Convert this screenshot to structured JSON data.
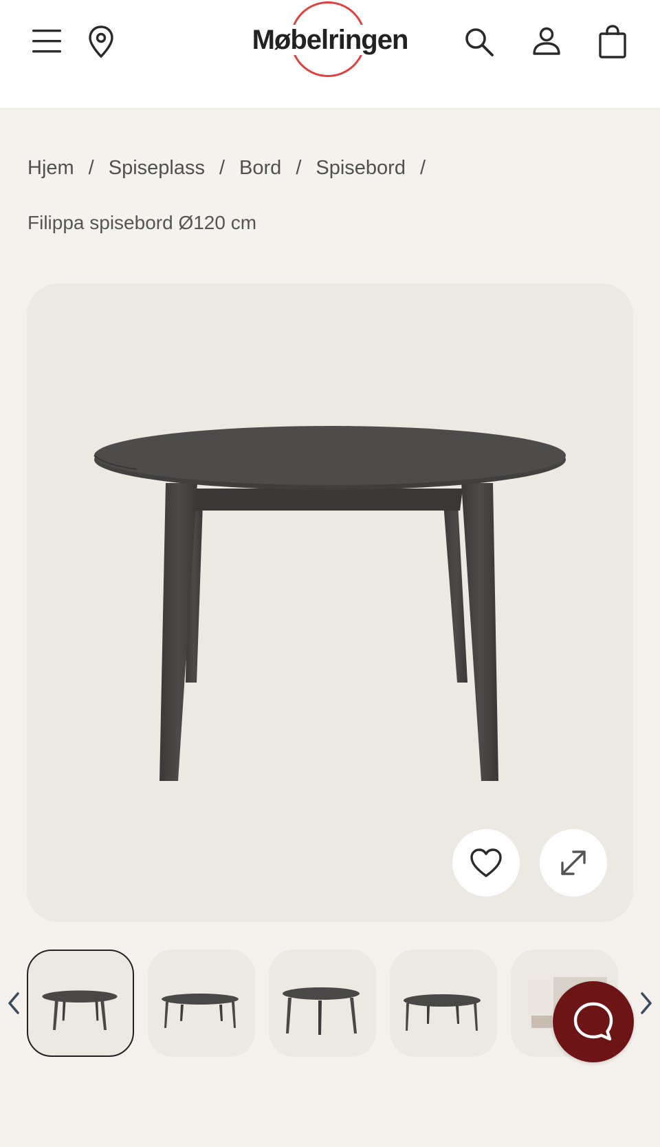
{
  "header": {
    "logo_text": "Møbelringen",
    "icons": [
      "menu-icon",
      "location-pin-icon",
      "search-icon",
      "user-icon",
      "shopping-bag-icon"
    ]
  },
  "breadcrumb": {
    "items": [
      "Hjem",
      "Spiseplass",
      "Bord",
      "Spisebord"
    ],
    "separator": "/"
  },
  "product": {
    "title": "Filippa spisebord Ø120 cm"
  },
  "gallery": {
    "actions": [
      "heart-icon",
      "expand-icon"
    ],
    "thumbnail_count": 5,
    "active_thumbnail": 1
  },
  "chat": {
    "icon": "chat-bubble-icon"
  },
  "colors": {
    "accent": "#e2403f",
    "chat_button": "#6d1416",
    "background": "#f5f1ed",
    "gallery_bg": "#ece8e2",
    "table_wood": "#4a4846"
  }
}
